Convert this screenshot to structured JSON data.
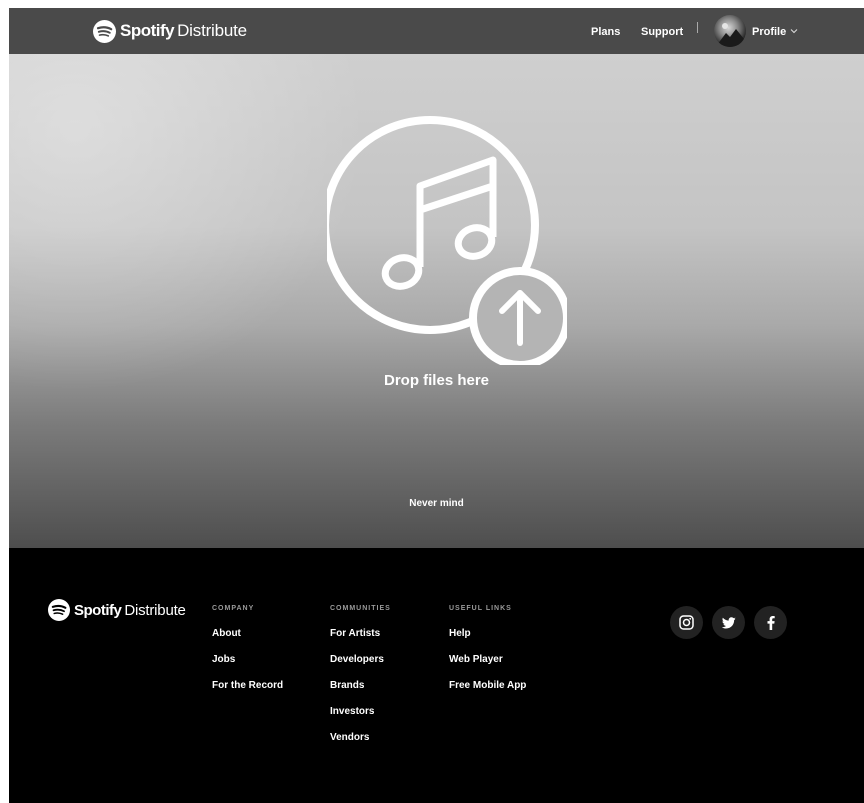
{
  "header": {
    "brand_name": "Spotify",
    "brand_product": "Distribute",
    "nav": {
      "plans": "Plans",
      "support": "Support",
      "profile": "Profile"
    }
  },
  "hero": {
    "drop_label": "Drop files here",
    "cancel_label": "Never mind",
    "icon": "music-upload-icon"
  },
  "footer": {
    "brand_name": "Spotify",
    "brand_product": "Distribute",
    "columns": [
      {
        "heading": "COMPANY",
        "links": [
          "About",
          "Jobs",
          "For the Record"
        ]
      },
      {
        "heading": "COMMUNITIES",
        "links": [
          "For Artists",
          "Developers",
          "Brands",
          "Investors",
          "Vendors"
        ]
      },
      {
        "heading": "USEFUL LINKS",
        "links": [
          "Help",
          "Web Player",
          "Free Mobile App"
        ]
      }
    ],
    "social": [
      "instagram-icon",
      "twitter-icon",
      "facebook-icon"
    ]
  },
  "colors": {
    "header_bg": "#4a4a4a",
    "footer_bg": "#000000",
    "social_bg": "#222222"
  }
}
